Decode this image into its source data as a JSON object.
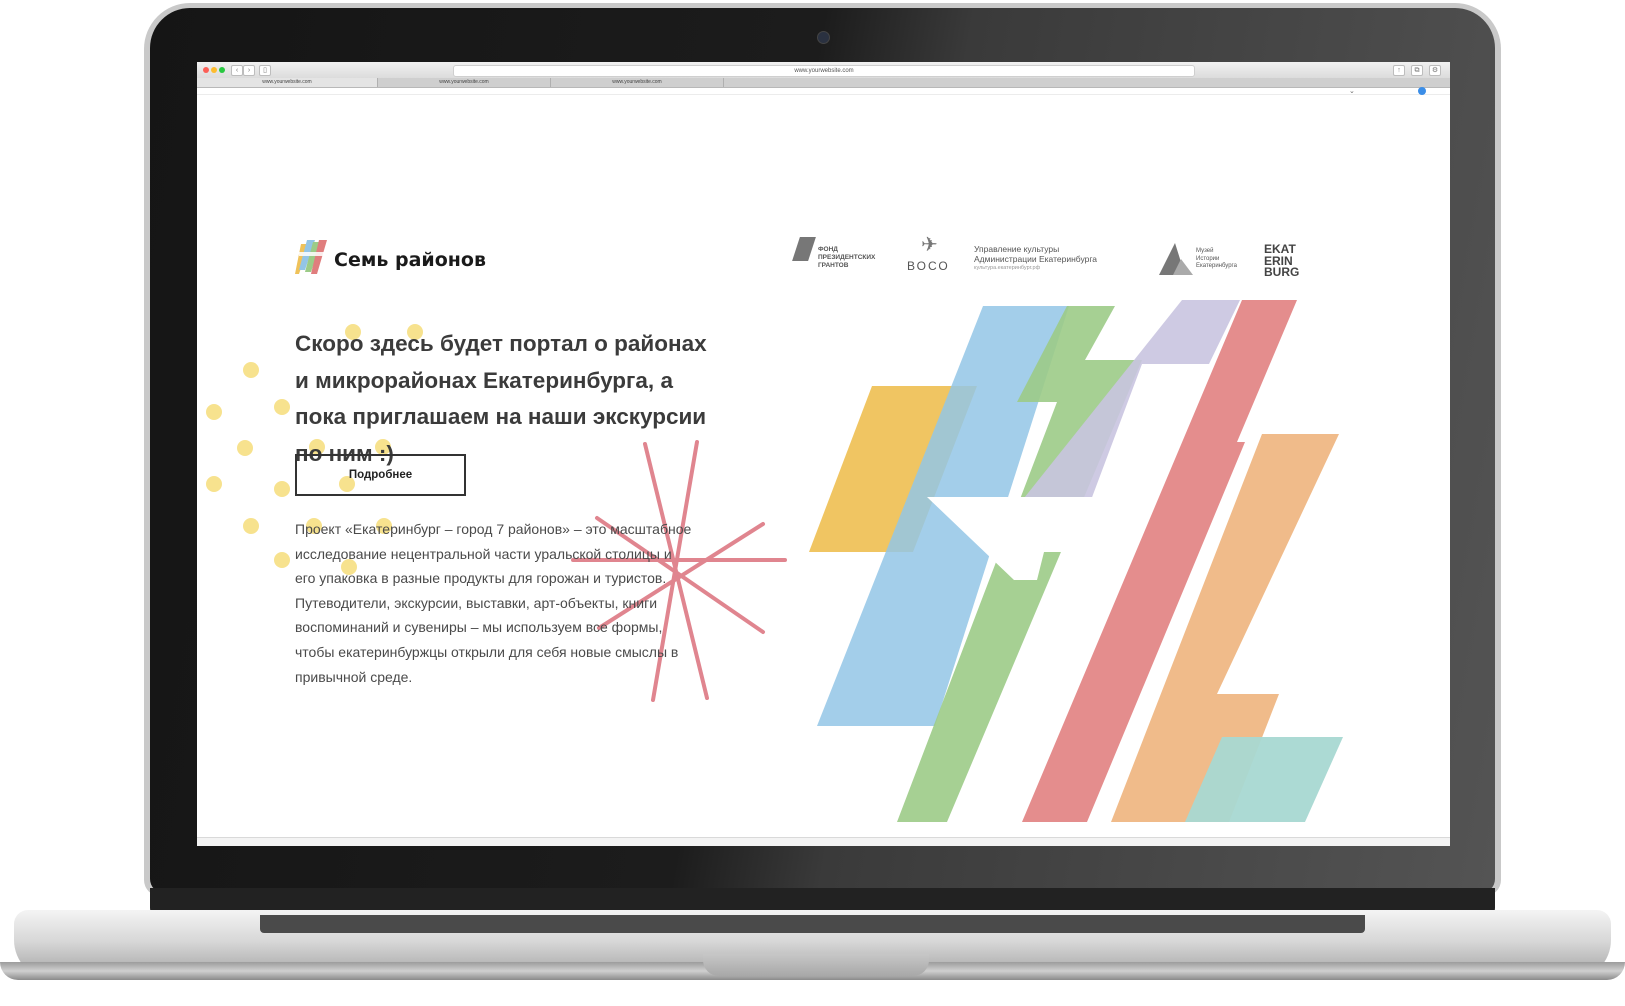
{
  "browser": {
    "url": "www.yourwebsite.com",
    "tabs": [
      "www.yourwebsite.com",
      "www.yourwebsite.com",
      "www.yourwebsite.com"
    ]
  },
  "site": {
    "logo_text": "Семь районов",
    "headline": "Скоро здесь будет портал о районах и микрорайонах Екатеринбурга, а пока приглашаем на наши экскурсии по ним :)",
    "cta_label": "Подробнее",
    "description": "Проект «Екатеринбург – город 7 районов» – это масштабное исследование нецентральной части уральской столицы и его упаковка в разные продукты для горожан и туристов. Путеводители, экскурсии, выставки, арт-объекты, книги воспоминаний и сувениры – мы используем все формы, чтобы екатеринбуржцы открыли для себя новые смыслы в привычной среде."
  },
  "partners": {
    "fund": [
      "ФОНД",
      "ПРЕЗИДЕНТСКИХ",
      "ГРАНТОВ"
    ],
    "voco": "ВОСО",
    "culture": [
      "Управление культуры",
      "Администрации Екатеринбурга",
      "культура.екатеринбург.рф"
    ],
    "museum": [
      "Музей",
      "Истории",
      "Екатеринбурга"
    ],
    "ekat": [
      "EKAT",
      "ERIN",
      "BURG"
    ]
  },
  "colors": {
    "yellow": "#efc25a",
    "blue": "#93c5e6",
    "green": "#9ccb87",
    "lavender": "#c9c4e0",
    "red": "#e07d7d",
    "orange": "#eeb27a",
    "teal": "#a8d8d2",
    "dot_yellow": "#f7e28e",
    "star_red": "#df7f8a"
  }
}
